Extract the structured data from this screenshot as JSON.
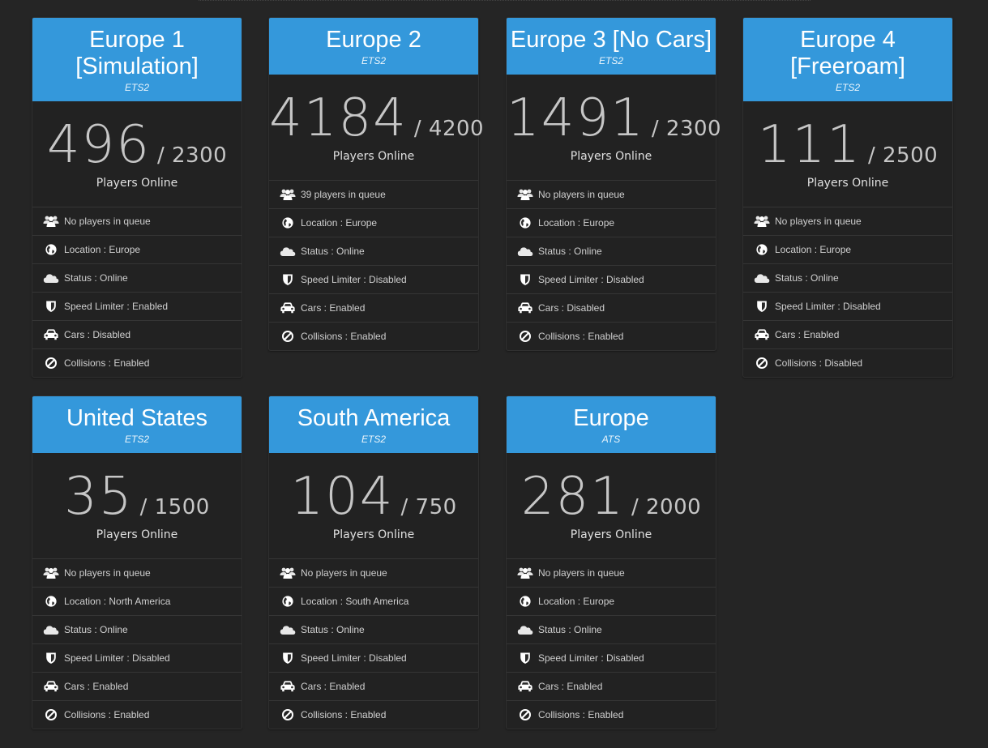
{
  "servers": [
    {
      "name": "Europe 1 [Simulation]",
      "game": "ETS2",
      "players": "496",
      "max": "/ 2300",
      "online_label": "Players Online",
      "queue": "No players in queue",
      "location": "Location : Europe",
      "status": "Status : Online",
      "speed": "Speed Limiter : Enabled",
      "cars": "Cars : Disabled",
      "collisions": "Collisions : Enabled"
    },
    {
      "name": "Europe 2",
      "game": "ETS2",
      "players": "4184",
      "max": "/ 4200",
      "online_label": "Players Online",
      "queue": "39 players in queue",
      "location": "Location : Europe",
      "status": "Status : Online",
      "speed": "Speed Limiter : Disabled",
      "cars": "Cars : Enabled",
      "collisions": "Collisions : Enabled"
    },
    {
      "name": "Europe 3 [No Cars]",
      "game": "ETS2",
      "players": "1491",
      "max": "/ 2300",
      "online_label": "Players Online",
      "queue": "No players in queue",
      "location": "Location : Europe",
      "status": "Status : Online",
      "speed": "Speed Limiter : Disabled",
      "cars": "Cars : Disabled",
      "collisions": "Collisions : Enabled"
    },
    {
      "name": "Europe 4 [Freeroam]",
      "game": "ETS2",
      "players": "111",
      "max": "/ 2500",
      "online_label": "Players Online",
      "queue": "No players in queue",
      "location": "Location : Europe",
      "status": "Status : Online",
      "speed": "Speed Limiter : Disabled",
      "cars": "Cars : Enabled",
      "collisions": "Collisions : Disabled"
    },
    {
      "name": "United States",
      "game": "ETS2",
      "players": "35",
      "max": "/ 1500",
      "online_label": "Players Online",
      "queue": "No players in queue",
      "location": "Location : North America",
      "status": "Status : Online",
      "speed": "Speed Limiter : Disabled",
      "cars": "Cars : Enabled",
      "collisions": "Collisions : Enabled"
    },
    {
      "name": "South America",
      "game": "ETS2",
      "players": "104",
      "max": "/ 750",
      "online_label": "Players Online",
      "queue": "No players in queue",
      "location": "Location : South America",
      "status": "Status : Online",
      "speed": "Speed Limiter : Disabled",
      "cars": "Cars : Enabled",
      "collisions": "Collisions : Enabled"
    },
    {
      "name": "Europe",
      "game": "ATS",
      "players": "281",
      "max": "/ 2000",
      "online_label": "Players Online",
      "queue": "No players in queue",
      "location": "Location : Europe",
      "status": "Status : Online",
      "speed": "Speed Limiter : Disabled",
      "cars": "Cars : Enabled",
      "collisions": "Collisions : Enabled"
    }
  ],
  "icons": {
    "queue": "users-icon",
    "location": "globe-icon",
    "status": "cloud-icon",
    "speed": "shield-icon",
    "cars": "car-icon",
    "collisions": "ban-icon"
  },
  "colors": {
    "header": "#3498db",
    "background": "#252525",
    "panel": "#222222"
  }
}
